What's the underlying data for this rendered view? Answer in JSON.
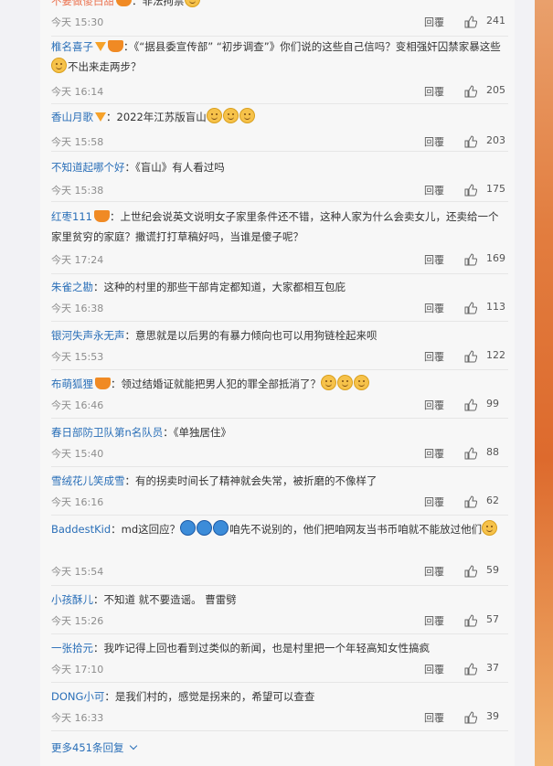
{
  "reply_label": "回覆",
  "more_replies": "更多451条回复",
  "comments": [
    {
      "user": "不要做傻白甜",
      "text": "：非法拘禁",
      "time": "今天 15:30",
      "likes": "241"
    },
    {
      "user": "椎名喜子",
      "text": "：《“据县委宣传部” “初步调查”》你们说的这些自己信吗？变相强奸囚禁家暴这些",
      "text2": "不出来走两步？",
      "time": "今天 16:14",
      "likes": "205"
    },
    {
      "user": "香山月歌",
      "text": "：2022年江苏版盲山",
      "time": "今天 15:58",
      "likes": "203"
    },
    {
      "user": "不知道起哪个好",
      "text": "：《盲山》有人看过吗",
      "time": "今天 15:38",
      "likes": "175"
    },
    {
      "user": "红枣111",
      "text": "：上世纪会说英文说明女子家里条件还不错，这种人家为什么会卖女儿，还卖给一个家里贫穷的家庭？撒谎打打草稿好吗，当谁是傻子呢？",
      "time": "今天 17:24",
      "likes": "169"
    },
    {
      "user": "朱雀之勘",
      "text": "：这种的村里的那些干部肯定都知道，大家都相互包庇",
      "time": "今天 16:38",
      "likes": "113"
    },
    {
      "user": "银河失声永无声",
      "text": "：意思就是以后男的有暴力倾向也可以用狗链栓起来呗",
      "time": "今天 15:53",
      "likes": "122"
    },
    {
      "user": "布萌狐狸",
      "text": "：领过结婚证就能把男人犯的罪全部抵消了？",
      "time": "今天 16:46",
      "likes": "99"
    },
    {
      "user": "春日部防卫队第n名队员",
      "text": "：《单独居住》",
      "time": "今天 15:40",
      "likes": "88"
    },
    {
      "user": "雪绒花儿笑成雪",
      "text": "：有的拐卖时间长了精神就会失常，被折磨的不像样了",
      "time": "今天 16:16",
      "likes": "62"
    },
    {
      "user": "BaddestKid",
      "text": "：md这回应？",
      "text2": "咱先不说别的，他们把咱网友当书币咱就不能放过他们",
      "time": "今天 15:54",
      "likes": "59"
    },
    {
      "user": "小孩酥儿",
      "text": "：不知道 就不要造谣。 曹雷劈",
      "time": "今天 15:26",
      "likes": "57"
    },
    {
      "user": "一张拾元",
      "text": "：我咋记得上回也看到过类似的新闻，也是村里把一个年轻高知女性搞疯",
      "time": "今天 17:10",
      "likes": "37"
    },
    {
      "user": "DONG小可",
      "text": "：是我们村的，感觉是拐来的，希望可以查查",
      "time": "今天 16:33",
      "likes": "39"
    }
  ]
}
